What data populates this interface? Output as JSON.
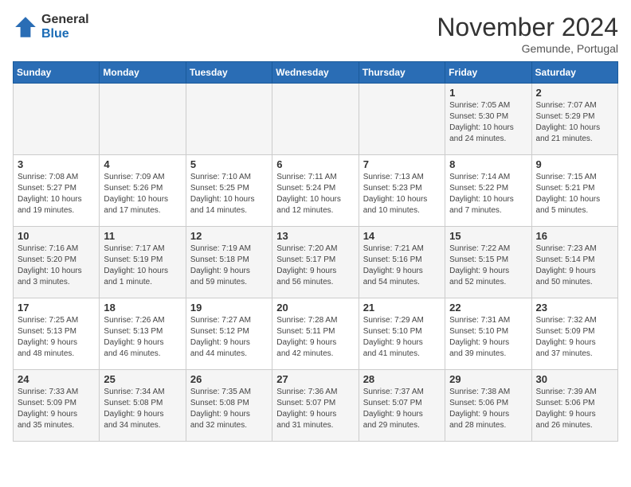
{
  "logo": {
    "general": "General",
    "blue": "Blue"
  },
  "header": {
    "month": "November 2024",
    "location": "Gemunde, Portugal"
  },
  "weekdays": [
    "Sunday",
    "Monday",
    "Tuesday",
    "Wednesday",
    "Thursday",
    "Friday",
    "Saturday"
  ],
  "weeks": [
    [
      {
        "day": "",
        "info": ""
      },
      {
        "day": "",
        "info": ""
      },
      {
        "day": "",
        "info": ""
      },
      {
        "day": "",
        "info": ""
      },
      {
        "day": "",
        "info": ""
      },
      {
        "day": "1",
        "info": "Sunrise: 7:05 AM\nSunset: 5:30 PM\nDaylight: 10 hours\nand 24 minutes."
      },
      {
        "day": "2",
        "info": "Sunrise: 7:07 AM\nSunset: 5:29 PM\nDaylight: 10 hours\nand 21 minutes."
      }
    ],
    [
      {
        "day": "3",
        "info": "Sunrise: 7:08 AM\nSunset: 5:27 PM\nDaylight: 10 hours\nand 19 minutes."
      },
      {
        "day": "4",
        "info": "Sunrise: 7:09 AM\nSunset: 5:26 PM\nDaylight: 10 hours\nand 17 minutes."
      },
      {
        "day": "5",
        "info": "Sunrise: 7:10 AM\nSunset: 5:25 PM\nDaylight: 10 hours\nand 14 minutes."
      },
      {
        "day": "6",
        "info": "Sunrise: 7:11 AM\nSunset: 5:24 PM\nDaylight: 10 hours\nand 12 minutes."
      },
      {
        "day": "7",
        "info": "Sunrise: 7:13 AM\nSunset: 5:23 PM\nDaylight: 10 hours\nand 10 minutes."
      },
      {
        "day": "8",
        "info": "Sunrise: 7:14 AM\nSunset: 5:22 PM\nDaylight: 10 hours\nand 7 minutes."
      },
      {
        "day": "9",
        "info": "Sunrise: 7:15 AM\nSunset: 5:21 PM\nDaylight: 10 hours\nand 5 minutes."
      }
    ],
    [
      {
        "day": "10",
        "info": "Sunrise: 7:16 AM\nSunset: 5:20 PM\nDaylight: 10 hours\nand 3 minutes."
      },
      {
        "day": "11",
        "info": "Sunrise: 7:17 AM\nSunset: 5:19 PM\nDaylight: 10 hours\nand 1 minute."
      },
      {
        "day": "12",
        "info": "Sunrise: 7:19 AM\nSunset: 5:18 PM\nDaylight: 9 hours\nand 59 minutes."
      },
      {
        "day": "13",
        "info": "Sunrise: 7:20 AM\nSunset: 5:17 PM\nDaylight: 9 hours\nand 56 minutes."
      },
      {
        "day": "14",
        "info": "Sunrise: 7:21 AM\nSunset: 5:16 PM\nDaylight: 9 hours\nand 54 minutes."
      },
      {
        "day": "15",
        "info": "Sunrise: 7:22 AM\nSunset: 5:15 PM\nDaylight: 9 hours\nand 52 minutes."
      },
      {
        "day": "16",
        "info": "Sunrise: 7:23 AM\nSunset: 5:14 PM\nDaylight: 9 hours\nand 50 minutes."
      }
    ],
    [
      {
        "day": "17",
        "info": "Sunrise: 7:25 AM\nSunset: 5:13 PM\nDaylight: 9 hours\nand 48 minutes."
      },
      {
        "day": "18",
        "info": "Sunrise: 7:26 AM\nSunset: 5:13 PM\nDaylight: 9 hours\nand 46 minutes."
      },
      {
        "day": "19",
        "info": "Sunrise: 7:27 AM\nSunset: 5:12 PM\nDaylight: 9 hours\nand 44 minutes."
      },
      {
        "day": "20",
        "info": "Sunrise: 7:28 AM\nSunset: 5:11 PM\nDaylight: 9 hours\nand 42 minutes."
      },
      {
        "day": "21",
        "info": "Sunrise: 7:29 AM\nSunset: 5:10 PM\nDaylight: 9 hours\nand 41 minutes."
      },
      {
        "day": "22",
        "info": "Sunrise: 7:31 AM\nSunset: 5:10 PM\nDaylight: 9 hours\nand 39 minutes."
      },
      {
        "day": "23",
        "info": "Sunrise: 7:32 AM\nSunset: 5:09 PM\nDaylight: 9 hours\nand 37 minutes."
      }
    ],
    [
      {
        "day": "24",
        "info": "Sunrise: 7:33 AM\nSunset: 5:09 PM\nDaylight: 9 hours\nand 35 minutes."
      },
      {
        "day": "25",
        "info": "Sunrise: 7:34 AM\nSunset: 5:08 PM\nDaylight: 9 hours\nand 34 minutes."
      },
      {
        "day": "26",
        "info": "Sunrise: 7:35 AM\nSunset: 5:08 PM\nDaylight: 9 hours\nand 32 minutes."
      },
      {
        "day": "27",
        "info": "Sunrise: 7:36 AM\nSunset: 5:07 PM\nDaylight: 9 hours\nand 31 minutes."
      },
      {
        "day": "28",
        "info": "Sunrise: 7:37 AM\nSunset: 5:07 PM\nDaylight: 9 hours\nand 29 minutes."
      },
      {
        "day": "29",
        "info": "Sunrise: 7:38 AM\nSunset: 5:06 PM\nDaylight: 9 hours\nand 28 minutes."
      },
      {
        "day": "30",
        "info": "Sunrise: 7:39 AM\nSunset: 5:06 PM\nDaylight: 9 hours\nand 26 minutes."
      }
    ]
  ]
}
